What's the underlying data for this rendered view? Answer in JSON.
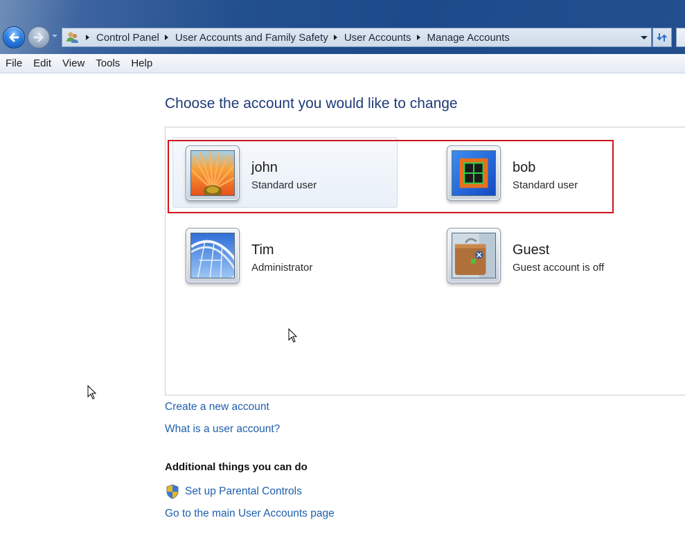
{
  "window": {
    "nav": {
      "back_label": "Back",
      "forward_label": "Forward"
    },
    "address_bar": {
      "icon": "user-accounts-icon",
      "breadcrumbs": [
        "Control Panel",
        "User Accounts and Family Safety",
        "User Accounts",
        "Manage Accounts"
      ]
    },
    "refresh_icon": "refresh-icon"
  },
  "menubar": {
    "items": [
      "File",
      "Edit",
      "View",
      "Tools",
      "Help"
    ]
  },
  "main": {
    "title": "Choose the account you would like to change",
    "accounts": [
      {
        "name": "john",
        "type": "Standard user",
        "picture": "orange-flower",
        "hovered": true,
        "highlighted": true
      },
      {
        "name": "bob",
        "type": "Standard user",
        "picture": "green-window-on-blue",
        "hovered": false,
        "highlighted": true
      },
      {
        "name": "Tim",
        "type": "Administrator",
        "picture": "roller-coaster",
        "hovered": false,
        "highlighted": false
      },
      {
        "name": "Guest",
        "type": "Guest account is off",
        "picture": "suitcase",
        "hovered": false,
        "highlighted": false
      }
    ],
    "links": {
      "create": "Create a new account",
      "what_is": "What is a user account?"
    },
    "additional": {
      "heading": "Additional things you can do",
      "parental_controls": "Set up Parental Controls",
      "main_page": "Go to the main User Accounts page"
    }
  },
  "colors": {
    "title_text": "#1e3a78",
    "link_text": "#1e5fad",
    "highlight_border": "#d0121b"
  }
}
